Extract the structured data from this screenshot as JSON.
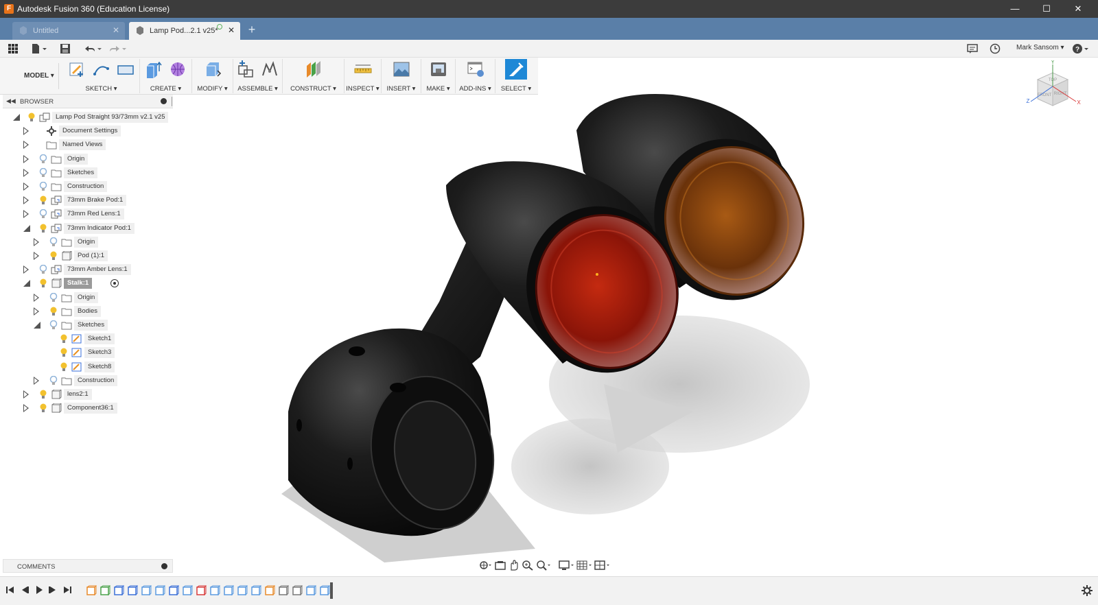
{
  "window": {
    "title": "Autodesk Fusion 360 (Education License)",
    "app_icon_letter": "F",
    "controls": [
      "minimize",
      "maximize",
      "close"
    ]
  },
  "tabs": [
    {
      "label": "Untitled",
      "active": false
    },
    {
      "label": "Lamp Pod...2.1 v25*",
      "active": true
    }
  ],
  "quick_access": {
    "icons": [
      "apps-grid-icon",
      "file-icon",
      "save-icon",
      "undo-icon",
      "redo-icon"
    ],
    "right_icons": [
      "notifications-icon",
      "job-status-icon",
      "help-icon"
    ],
    "user_name": "Mark Sansom ▾"
  },
  "ribbon": {
    "workspace": "MODEL ▾",
    "groups": [
      {
        "label": "SKETCH ▾",
        "icons": [
          "create-sketch-icon",
          "line-icon",
          "rectangle-icon"
        ]
      },
      {
        "label": "CREATE ▾",
        "icons": [
          "extrude-icon",
          "form-icon"
        ]
      },
      {
        "label": "MODIFY ▾",
        "icons": [
          "press-pull-icon"
        ]
      },
      {
        "label": "ASSEMBLE ▾",
        "icons": [
          "new-component-icon",
          "joint-icon"
        ]
      },
      {
        "label": "CONSTRUCT ▾",
        "icons": [
          "offset-plane-icon"
        ]
      },
      {
        "label": "INSPECT ▾",
        "icons": [
          "measure-icon"
        ]
      },
      {
        "label": "INSERT ▾",
        "icons": [
          "insert-image-icon"
        ]
      },
      {
        "label": "MAKE ▾",
        "icons": [
          "3d-print-icon"
        ]
      },
      {
        "label": "ADD-INS ▾",
        "icons": [
          "scripts-icon"
        ]
      },
      {
        "label": "SELECT ▾",
        "icons": [
          "select-icon"
        ]
      }
    ]
  },
  "browser": {
    "title": "BROWSER",
    "nodes": [
      {
        "label": "Lamp Pod Straight 93/73mm v2.1 v25",
        "depth": 0,
        "expanded": true,
        "icon": "assembly"
      },
      {
        "label": "Document Settings",
        "depth": 1,
        "expanded": false,
        "icon": "gear"
      },
      {
        "label": "Named Views",
        "depth": 1,
        "expanded": false,
        "icon": "folder"
      },
      {
        "label": "Origin",
        "depth": 1,
        "expanded": false,
        "icon": "folder"
      },
      {
        "label": "Sketches",
        "depth": 1,
        "expanded": false,
        "icon": "folder"
      },
      {
        "label": "Construction",
        "depth": 1,
        "expanded": false,
        "icon": "folder"
      },
      {
        "label": "73mm Brake Pod:1",
        "depth": 1,
        "expanded": false,
        "icon": "component-link"
      },
      {
        "label": "73mm Red Lens:1",
        "depth": 1,
        "expanded": false,
        "icon": "component-link"
      },
      {
        "label": "73mm Indicator Pod:1",
        "depth": 1,
        "expanded": true,
        "icon": "component-link"
      },
      {
        "label": "Origin",
        "depth": 2,
        "expanded": false,
        "icon": "folder"
      },
      {
        "label": "Pod (1):1",
        "depth": 2,
        "expanded": false,
        "icon": "component"
      },
      {
        "label": "73mm Amber Lens:1",
        "depth": 1,
        "expanded": false,
        "icon": "component-link"
      },
      {
        "label": "Stalk:1",
        "depth": 1,
        "expanded": true,
        "icon": "component",
        "active": true
      },
      {
        "label": "Origin",
        "depth": 2,
        "expanded": false,
        "icon": "folder"
      },
      {
        "label": "Bodies",
        "depth": 2,
        "expanded": false,
        "icon": "folder"
      },
      {
        "label": "Sketches",
        "depth": 2,
        "expanded": true,
        "icon": "folder"
      },
      {
        "label": "Sketch1",
        "depth": 3,
        "leaf": true,
        "icon": "sketch"
      },
      {
        "label": "Sketch3",
        "depth": 3,
        "leaf": true,
        "icon": "sketch"
      },
      {
        "label": "Sketch8",
        "depth": 3,
        "leaf": true,
        "icon": "sketch"
      },
      {
        "label": "Construction",
        "depth": 2,
        "expanded": false,
        "icon": "folder"
      },
      {
        "label": "lens2:1",
        "depth": 1,
        "expanded": false,
        "icon": "component"
      },
      {
        "label": "Component36:1",
        "depth": 1,
        "expanded": false,
        "icon": "component"
      }
    ]
  },
  "comments": {
    "title": "COMMENTS"
  },
  "viewcube": {
    "faces": [
      "TOP",
      "FRONT",
      "RIGHT"
    ],
    "axes": [
      "X",
      "Y",
      "Z"
    ]
  },
  "navbar": {
    "icons": [
      "orbit-icon",
      "look-at-icon",
      "pan-icon",
      "zoom-icon",
      "fit-icon",
      "display-settings-icon",
      "grid-icon",
      "viewports-icon"
    ]
  },
  "timeline": {
    "controls": [
      "first-icon",
      "previous-icon",
      "play-icon",
      "next-icon",
      "last-icon"
    ],
    "feature_count": 18
  },
  "colors": {
    "titlebar": "#3c3c3c",
    "tabbar": "#5a7fa8",
    "accent": "#1e88d6",
    "bulb_on": "#f2c12e",
    "bulb_off": "#8fb3d9",
    "body": "#111111",
    "red_lens": "#a0180c",
    "amber_lens": "#b0631a"
  }
}
